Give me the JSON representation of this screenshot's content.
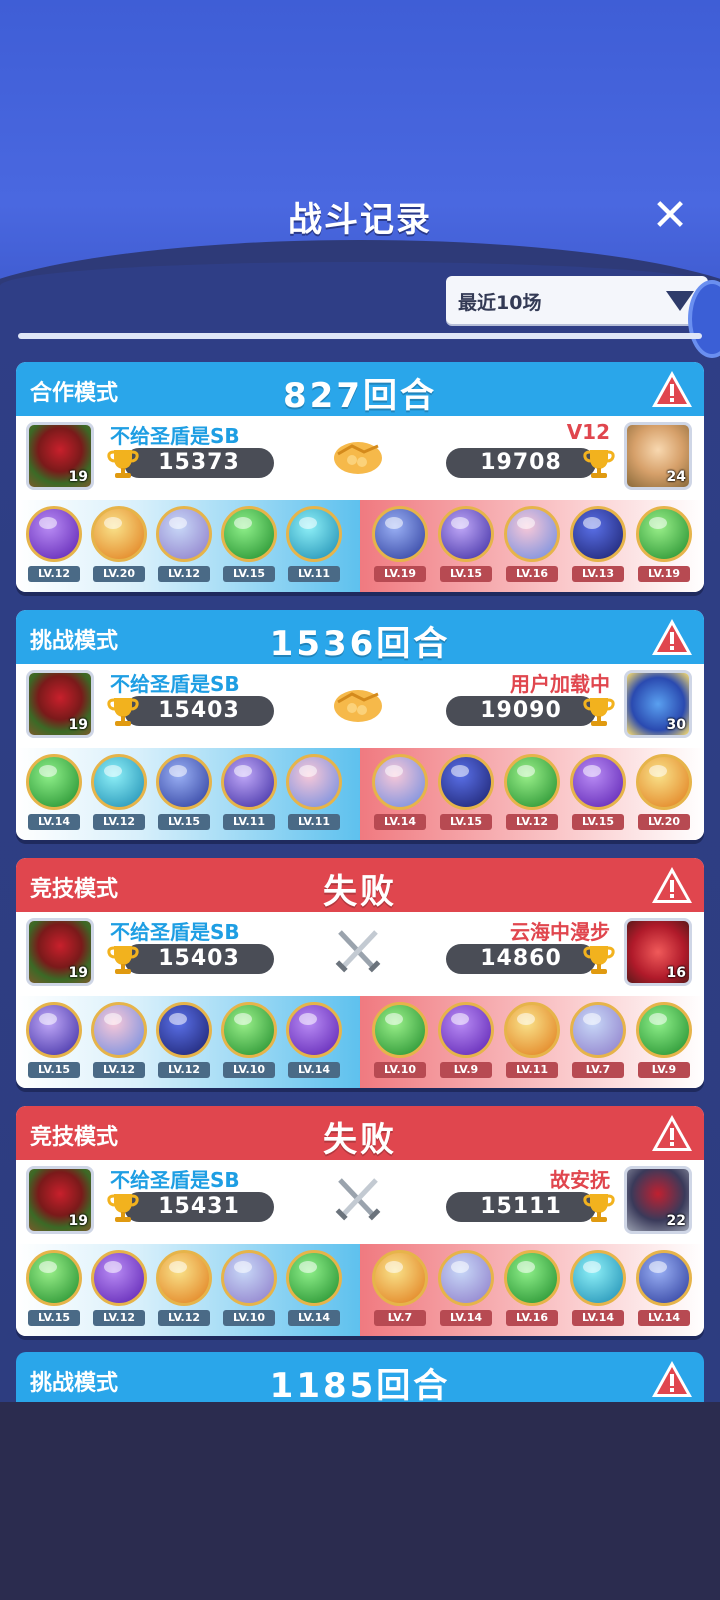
{
  "header": {
    "title": "战斗记录"
  },
  "filter": {
    "selected": "最近10场"
  },
  "colors": {
    "coop_header": "#2aa6ea",
    "lose_header": "#e0464e"
  },
  "matches": [
    {
      "mode": "合作模式",
      "result": "827回合",
      "status": "win",
      "vs_icon": "handshake-icon",
      "me": {
        "name": "不给圣盾是SB",
        "score": "15373",
        "level": "19"
      },
      "opp": {
        "name": "V12",
        "score": "19708",
        "level": "24"
      },
      "my_team": [
        "LV.12",
        "LV.20",
        "LV.12",
        "LV.15",
        "LV.11"
      ],
      "opp_team": [
        "LV.19",
        "LV.15",
        "LV.16",
        "LV.13",
        "LV.19"
      ]
    },
    {
      "mode": "挑战模式",
      "result": "1536回合",
      "status": "win",
      "vs_icon": "handshake-icon",
      "me": {
        "name": "不给圣盾是SB",
        "score": "15403",
        "level": "19"
      },
      "opp": {
        "name": "用户加载中",
        "score": "19090",
        "level": "30"
      },
      "my_team": [
        "LV.14",
        "LV.12",
        "LV.15",
        "LV.11",
        "LV.11"
      ],
      "opp_team": [
        "LV.14",
        "LV.15",
        "LV.12",
        "LV.15",
        "LV.20"
      ]
    },
    {
      "mode": "竞技模式",
      "result": "失败",
      "status": "lose",
      "vs_icon": "crossed-swords-icon",
      "me": {
        "name": "不给圣盾是SB",
        "score": "15403",
        "level": "19"
      },
      "opp": {
        "name": "云海中漫步",
        "score": "14860",
        "level": "16"
      },
      "my_team": [
        "LV.15",
        "LV.12",
        "LV.12",
        "LV.10",
        "LV.14"
      ],
      "opp_team": [
        "LV.10",
        "LV.9",
        "LV.11",
        "LV.7",
        "LV.9"
      ]
    },
    {
      "mode": "竞技模式",
      "result": "失败",
      "status": "lose",
      "vs_icon": "crossed-swords-icon",
      "me": {
        "name": "不给圣盾是SB",
        "score": "15431",
        "level": "19"
      },
      "opp": {
        "name": "故安抚",
        "score": "15111",
        "level": "22"
      },
      "my_team": [
        "LV.15",
        "LV.12",
        "LV.12",
        "LV.10",
        "LV.14"
      ],
      "opp_team": [
        "LV.7",
        "LV.14",
        "LV.16",
        "LV.14",
        "LV.14"
      ]
    }
  ],
  "partial_match": {
    "mode": "挑战模式",
    "result": "1185回合"
  }
}
